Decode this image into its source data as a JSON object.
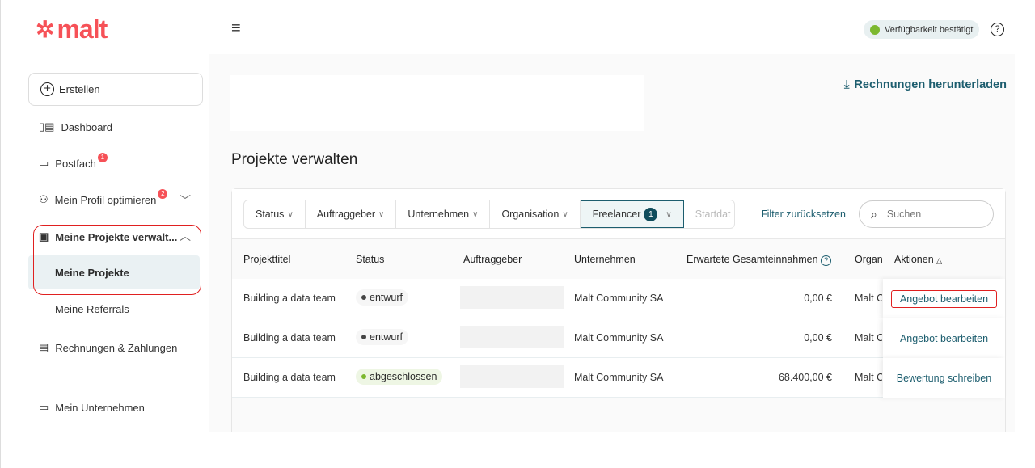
{
  "logo": "malt",
  "header": {
    "availability": "Verfügbarkeit bestätigt",
    "availability_color": "#7cb82f"
  },
  "sidebar": {
    "create": "Erstellen",
    "items": [
      {
        "label": "Dashboard"
      },
      {
        "label": "Postfach",
        "badge": "1"
      },
      {
        "label": "Mein Profil optimieren",
        "badge": "2"
      },
      {
        "label": "Meine Projekte verwalt..."
      },
      {
        "label": "Meine Projekte"
      },
      {
        "label": "Meine Referrals"
      },
      {
        "label": "Rechnungen & Zahlungen"
      },
      {
        "label": "Mein Unternehmen"
      }
    ]
  },
  "main": {
    "download": "Rechnungen herunterladen",
    "title": "Projekte verwalten",
    "filters": [
      "Status",
      "Auftraggeber",
      "Unternehmen",
      "Organisation",
      "Freelancer",
      "Startdat"
    ],
    "freelancer_count": "1",
    "reset": "Filter zurücksetzen",
    "search_placeholder": "Suchen",
    "columns": [
      "Projekttitel",
      "Status",
      "Auftraggeber",
      "Unternehmen",
      "Erwartete Gesamteinnahmen",
      "Organ",
      "Aktionen"
    ],
    "rows": [
      {
        "title": "Building a data team",
        "status": "entwurf",
        "company": "Malt Community SA",
        "amount": "0,00 €",
        "org": "Malt C",
        "action": "Angebot bearbeiten"
      },
      {
        "title": "Building a data team",
        "status": "entwurf",
        "company": "Malt Community SA",
        "amount": "0,00 €",
        "org": "Malt C",
        "action": "Angebot bearbeiten"
      },
      {
        "title": "Building a data team",
        "status": "abgeschlossen",
        "company": "Malt Community SA",
        "amount": "68.400,00 €",
        "org": "Malt C",
        "action": "Bewertung schreiben"
      }
    ]
  }
}
